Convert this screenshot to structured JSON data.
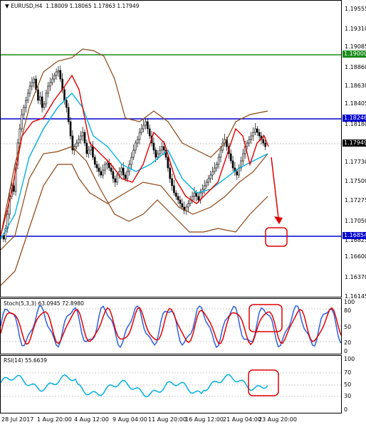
{
  "main": {
    "title": "EURUSD,H4",
    "ohlc": "1.18009 1.18065 1.17863 1.17949",
    "price_axis": [
      "1.19555",
      "1.19310",
      "1.19085",
      "1.18860",
      "1.18630",
      "1.18405",
      "1.18180",
      "1.17730",
      "1.17500",
      "1.17275",
      "1.17050",
      "1.16825",
      "1.16600",
      "1.16370",
      "1.16145"
    ],
    "badges": {
      "green": {
        "text": "1.19000",
        "color": "#1a8a1a"
      },
      "upper": {
        "text": "1.18246",
        "color": "#0000d0"
      },
      "current": {
        "text": "1.17949",
        "color": "#000000"
      },
      "lower": {
        "text": "1.16854",
        "color": "#0000d0"
      }
    }
  },
  "stoch": {
    "title": "Stoch(5,3,3) 63.0945 72.8980",
    "levels": [
      "100",
      "80",
      "50",
      "20",
      "0"
    ]
  },
  "rsi": {
    "title": "RSI(14) 55.6639",
    "levels": [
      "100",
      "70",
      "50",
      "30",
      "0"
    ]
  },
  "time_axis": [
    "28 Jul 2017",
    "1 Aug 20:00",
    "4 Aug 12:00",
    "9 Aug 04:00",
    "11 Aug 20:00",
    "16 Aug 12:00",
    "21 Aug 04:00",
    "23 Aug 20:00"
  ],
  "colors": {
    "accent": "#ff0000",
    "ma_cyan": "#00b0e0",
    "band_brown": "#8b4513",
    "stoch_blue": "#3060e0"
  }
}
